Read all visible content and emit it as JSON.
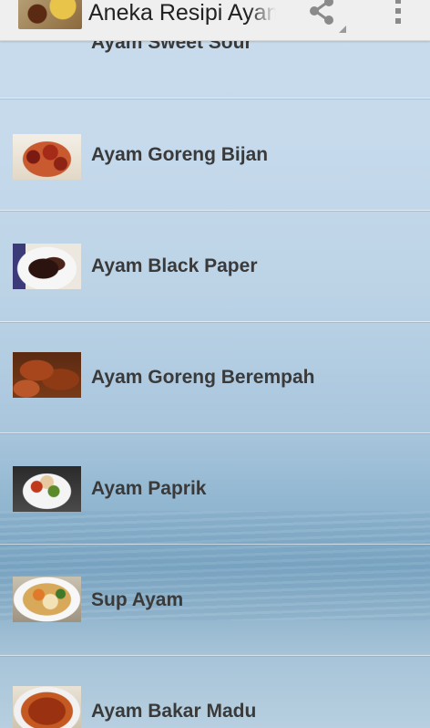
{
  "app": {
    "title": "Aneka Resipi Ayam",
    "icon": "app-food-thumbnail-icon"
  },
  "actionbar": {
    "share_icon": "share-icon",
    "overflow_icon": "overflow-menu-icon"
  },
  "recipes": [
    {
      "label": "Ayam Sweet Sour"
    },
    {
      "label": "Ayam Goreng Bijan"
    },
    {
      "label": "Ayam Black Paper"
    },
    {
      "label": "Ayam Goreng Berempah"
    },
    {
      "label": "Ayam Paprik"
    },
    {
      "label": "Sup Ayam"
    },
    {
      "label": "Ayam Bakar Madu"
    }
  ],
  "colors": {
    "actionbar_bg": "#efefef",
    "label_text": "#3a3a3a",
    "background_top": "#c9dced",
    "background_sea": "#7ba6c4"
  }
}
